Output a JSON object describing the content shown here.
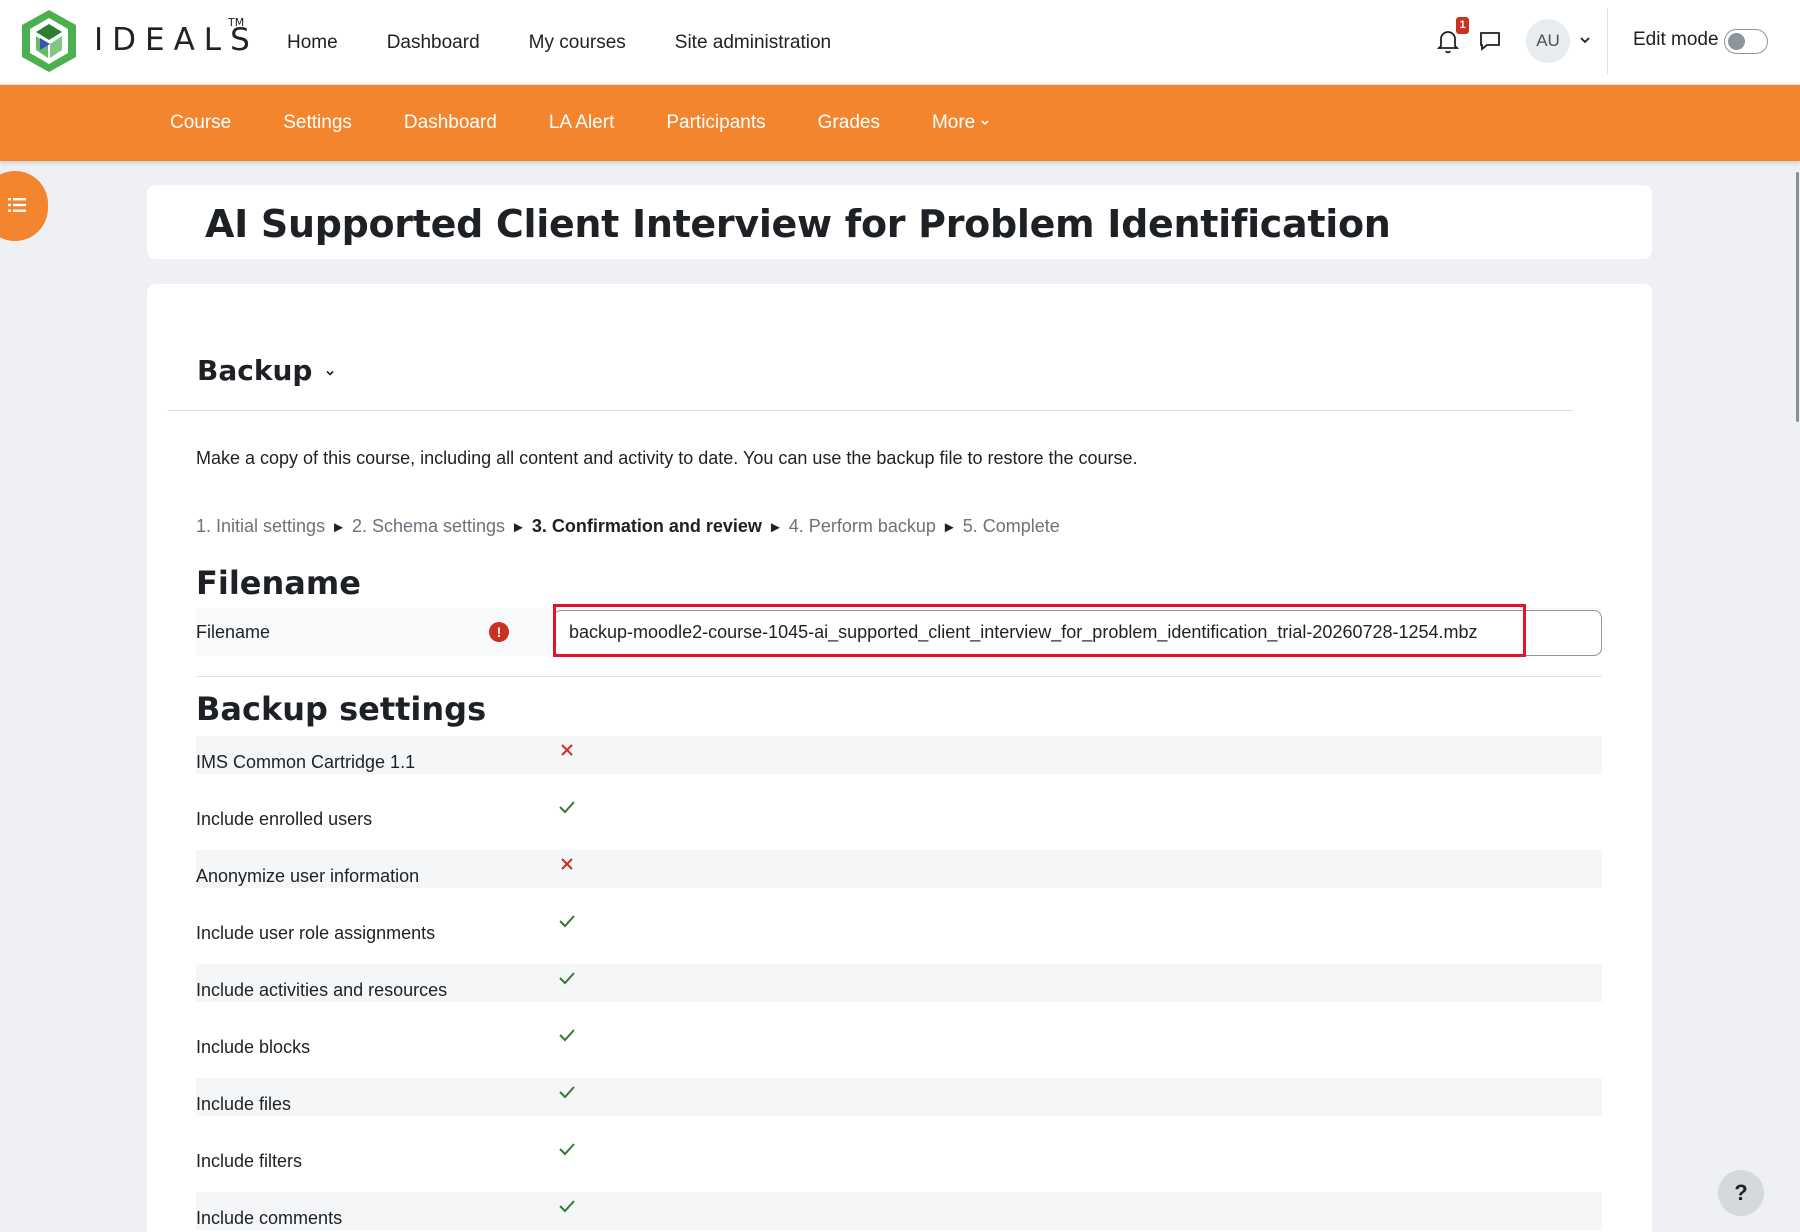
{
  "brand": {
    "name": "IDEALS",
    "tm": "TM"
  },
  "primary_nav": [
    "Home",
    "Dashboard",
    "My courses",
    "Site administration"
  ],
  "notifications": {
    "count": "1"
  },
  "user": {
    "initials": "AU"
  },
  "edit_mode": {
    "label": "Edit mode",
    "enabled": false
  },
  "secondary_nav": [
    "Course",
    "Settings",
    "Dashboard",
    "LA Alert",
    "Participants",
    "Grades",
    "More"
  ],
  "page_title": "AI Supported Client Interview for Problem Identification",
  "backup": {
    "heading": "Backup",
    "intro": "Make a copy of this course, including all content and activity to date. You can use the backup file to restore the course.",
    "steps": [
      "1. Initial settings",
      "2. Schema settings",
      "3. Confirmation and review",
      "4. Perform backup",
      "5. Complete"
    ],
    "current_step": 2,
    "filename_heading": "Filename",
    "filename_label": "Filename",
    "filename_value": "backup-moodle2-course-1045-ai_supported_client_interview_for_problem_identification_trial-20260728-1254.mbz",
    "settings_heading": "Backup settings",
    "settings": [
      {
        "label": "IMS Common Cartridge 1.1",
        "value": false
      },
      {
        "label": "Include enrolled users",
        "value": true
      },
      {
        "label": "Anonymize user information",
        "value": false
      },
      {
        "label": "Include user role assignments",
        "value": true
      },
      {
        "label": "Include activities and resources",
        "value": true
      },
      {
        "label": "Include blocks",
        "value": true
      },
      {
        "label": "Include files",
        "value": true
      },
      {
        "label": "Include filters",
        "value": true
      },
      {
        "label": "Include comments",
        "value": true
      }
    ]
  },
  "colors": {
    "accent": "#f3852e",
    "success": "#357a32",
    "error": "#ca3120",
    "highlight": "#e2132a"
  },
  "help_label": "?"
}
